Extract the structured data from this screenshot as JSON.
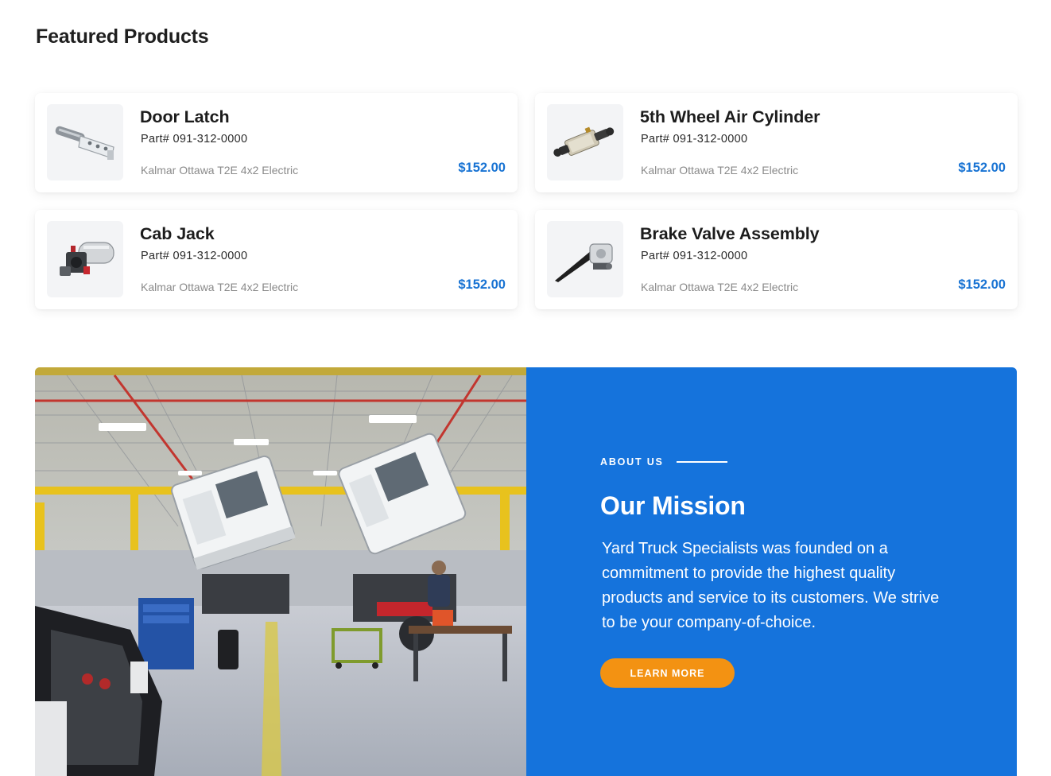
{
  "section": {
    "title": "Featured Products"
  },
  "products": [
    {
      "name": "Door Latch",
      "part": "Part# 091-312-0000",
      "fitment": "Kalmar Ottawa T2E 4x2 Electric",
      "price": "$152.00",
      "image_icon": "door-latch-icon"
    },
    {
      "name": "5th Wheel Air Cylinder",
      "part": "Part# 091-312-0000",
      "fitment": "Kalmar Ottawa T2E 4x2 Electric",
      "price": "$152.00",
      "image_icon": "air-cylinder-icon"
    },
    {
      "name": "Cab Jack",
      "part": "Part# 091-312-0000",
      "fitment": "Kalmar Ottawa T2E 4x2 Electric",
      "price": "$152.00",
      "image_icon": "cab-jack-icon"
    },
    {
      "name": "Brake Valve Assembly",
      "part": "Part# 091-312-0000",
      "fitment": "Kalmar Ottawa T2E 4x2 Electric",
      "price": "$152.00",
      "image_icon": "brake-valve-icon"
    }
  ],
  "about": {
    "eyebrow": "ABOUT US",
    "title": "Our Mission",
    "body": "Yard Truck Specialists was founded on a commitment to provide the highest quality products and service to its customers. We strive to be your company-of-choice.",
    "button_label": "LEARN MORE",
    "photo_icon": "workshop-photo"
  },
  "colors": {
    "accent_blue": "#1573dc",
    "price_blue": "#1873d3",
    "button_orange": "#f39212"
  }
}
